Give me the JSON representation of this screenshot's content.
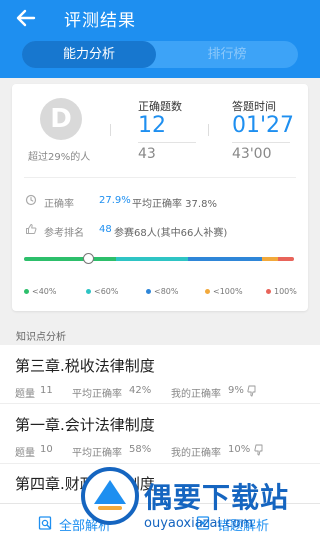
{
  "header": {
    "title": "评测结果",
    "tabs": [
      {
        "label": "能力分析",
        "active": true
      },
      {
        "label": "排行榜",
        "active": false
      }
    ]
  },
  "summary": {
    "avatar_letter": "D",
    "beat_text": "超过29%的人",
    "correct_count": {
      "label": "正确题数",
      "value": "12",
      "sub": "43"
    },
    "answer_time": {
      "label": "答题时间",
      "value": "01'27",
      "sub": "43'00"
    },
    "accuracy": {
      "label": "正确率",
      "value": "27.9%",
      "avg_text": "平均正确率 37.8%"
    },
    "ranking": {
      "label": "参考排名",
      "value": "48",
      "detail": "参赛68人(其中66人补赛)"
    },
    "score_position_fraction": 0.24,
    "legend": [
      {
        "label": "<40%",
        "color": "#2dbf6b"
      },
      {
        "label": "<60%",
        "color": "#2ec4c4"
      },
      {
        "label": "<80%",
        "color": "#2f86d8"
      },
      {
        "label": "<100%",
        "color": "#f2a93b"
      },
      {
        "label": "100%",
        "color": "#e8645a"
      }
    ]
  },
  "knowledge": {
    "section_title": "知识点分析",
    "items": [
      {
        "title": "第三章.税收法律制度",
        "count_label": "题量",
        "count": "11",
        "avg_label": "平均正确率",
        "avg": "42%",
        "mine_label": "我的正确率",
        "mine": "9%"
      },
      {
        "title": "第一章.会计法律制度",
        "count_label": "题量",
        "count": "10",
        "avg_label": "平均正确率",
        "avg": "58%",
        "mine_label": "我的正确率",
        "mine": "10%"
      },
      {
        "title": "第四章.财政法律制度"
      }
    ]
  },
  "bottom_bar": {
    "analysis_all": "全部解析",
    "analysis_wrong": "错题解析"
  },
  "watermark": {
    "brand": "偶要下载站",
    "url": "ouyaoxiazai.com"
  },
  "colors": {
    "primary": "#1e8ff0",
    "header_active": "#1777cf"
  }
}
